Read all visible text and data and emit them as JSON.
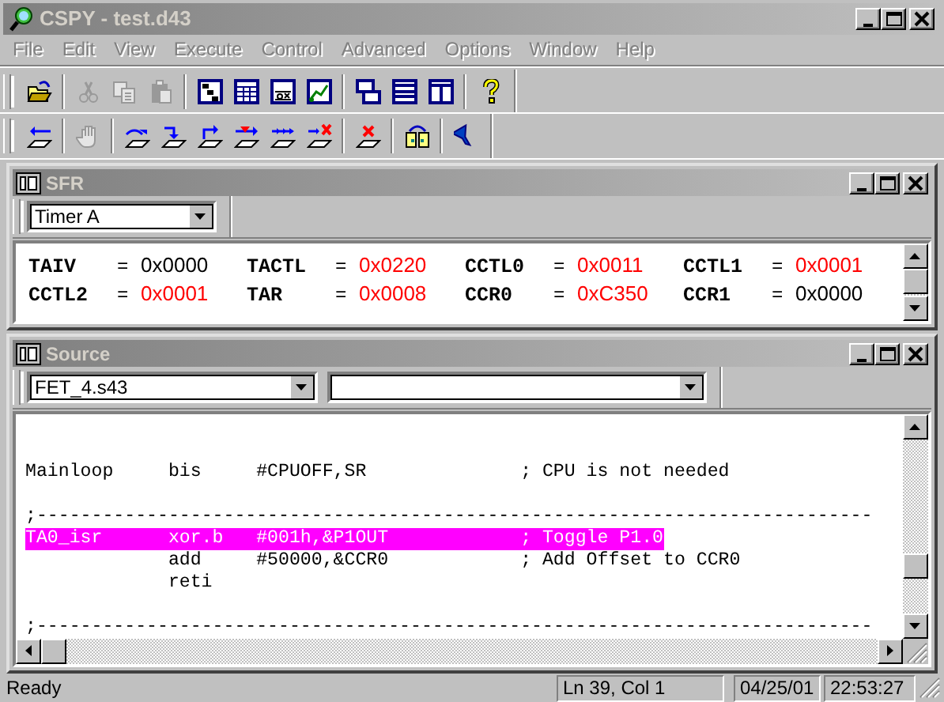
{
  "window": {
    "title": "CSPY - test.d43",
    "active": false
  },
  "menu": [
    {
      "label": "File"
    },
    {
      "label": "Edit"
    },
    {
      "label": "View"
    },
    {
      "label": "Execute"
    },
    {
      "label": "Control"
    },
    {
      "label": "Advanced"
    },
    {
      "label": "Options"
    },
    {
      "label": "Window"
    },
    {
      "label": "Help"
    }
  ],
  "toolbars": [
    [
      {
        "kind": "open",
        "disabled": false
      },
      {
        "kind": "sep"
      },
      {
        "kind": "cut",
        "disabled": true
      },
      {
        "kind": "copy",
        "disabled": true
      },
      {
        "kind": "paste",
        "disabled": true
      },
      {
        "kind": "sep"
      },
      {
        "kind": "tree",
        "disabled": false
      },
      {
        "kind": "table",
        "disabled": false
      },
      {
        "kind": "hex",
        "disabled": false
      },
      {
        "kind": "graph",
        "disabled": false
      },
      {
        "kind": "sep"
      },
      {
        "kind": "cascade",
        "disabled": false
      },
      {
        "kind": "htile",
        "disabled": false
      },
      {
        "kind": "vtile",
        "disabled": false
      },
      {
        "kind": "sep"
      },
      {
        "kind": "help",
        "disabled": false
      }
    ],
    [
      {
        "kind": "reset",
        "disabled": false
      },
      {
        "kind": "sep"
      },
      {
        "kind": "hand",
        "disabled": true
      },
      {
        "kind": "sep"
      },
      {
        "kind": "stepover",
        "disabled": false
      },
      {
        "kind": "stepinto",
        "disabled": false
      },
      {
        "kind": "stepout",
        "disabled": false
      },
      {
        "kind": "tocursor",
        "disabled": false
      },
      {
        "kind": "multistep",
        "disabled": false
      },
      {
        "kind": "stepstop",
        "disabled": false
      },
      {
        "kind": "sep"
      },
      {
        "kind": "clear",
        "disabled": false
      },
      {
        "kind": "sep"
      },
      {
        "kind": "swap",
        "disabled": false
      },
      {
        "kind": "sep"
      },
      {
        "kind": "funnel",
        "disabled": false
      }
    ]
  ],
  "sfr": {
    "title": "SFR",
    "group": "Timer A",
    "registers": [
      {
        "name": "TAIV",
        "equals": "=",
        "value": "0x0000",
        "changed": false
      },
      {
        "name": "TACTL",
        "equals": "=",
        "value": "0x0220",
        "changed": true
      },
      {
        "name": "CCTL0",
        "equals": "=",
        "value": "0x0011",
        "changed": true
      },
      {
        "name": "CCTL1",
        "equals": "=",
        "value": "0x0001",
        "changed": true
      },
      {
        "name": "CCTL2",
        "equals": "=",
        "value": "0x0001",
        "changed": true
      },
      {
        "name": "TAR",
        "equals": "=",
        "value": "0x0008",
        "changed": true
      },
      {
        "name": "CCR0",
        "equals": "=",
        "value": "0xC350",
        "changed": true
      },
      {
        "name": "CCR1",
        "equals": "=",
        "value": "0x0000",
        "changed": false
      }
    ]
  },
  "source": {
    "title": "Source",
    "file": "FET_4.s43",
    "lines": [
      {
        "kind": "blank"
      },
      {
        "kind": "blank"
      },
      {
        "kind": "code",
        "label": "Mainloop",
        "op": "bis",
        "operand": "#CPUOFF,SR",
        "comment": "; CPU is not needed",
        "selected": false
      },
      {
        "kind": "blank"
      },
      {
        "kind": "separator",
        "text": ";----------------------------------------------------------------------------"
      },
      {
        "kind": "code",
        "label": "TA0_isr",
        "op": "xor.b",
        "operand": "#001h,&P1OUT",
        "comment": "; Toggle P1.0",
        "selected": true
      },
      {
        "kind": "code",
        "op": "add",
        "operand": "#50000,&CCR0",
        "comment": "; Add Offset to CCR0",
        "selected": false
      },
      {
        "kind": "code",
        "op": "reti",
        "selected": false
      },
      {
        "kind": "blank"
      },
      {
        "kind": "separator",
        "text": ";----------------------------------------------------------------------------"
      }
    ]
  },
  "status_bar": {
    "message": "Ready",
    "position": "Ln 39, Col 1",
    "date": "04/25/01",
    "time": "22:53:27"
  }
}
